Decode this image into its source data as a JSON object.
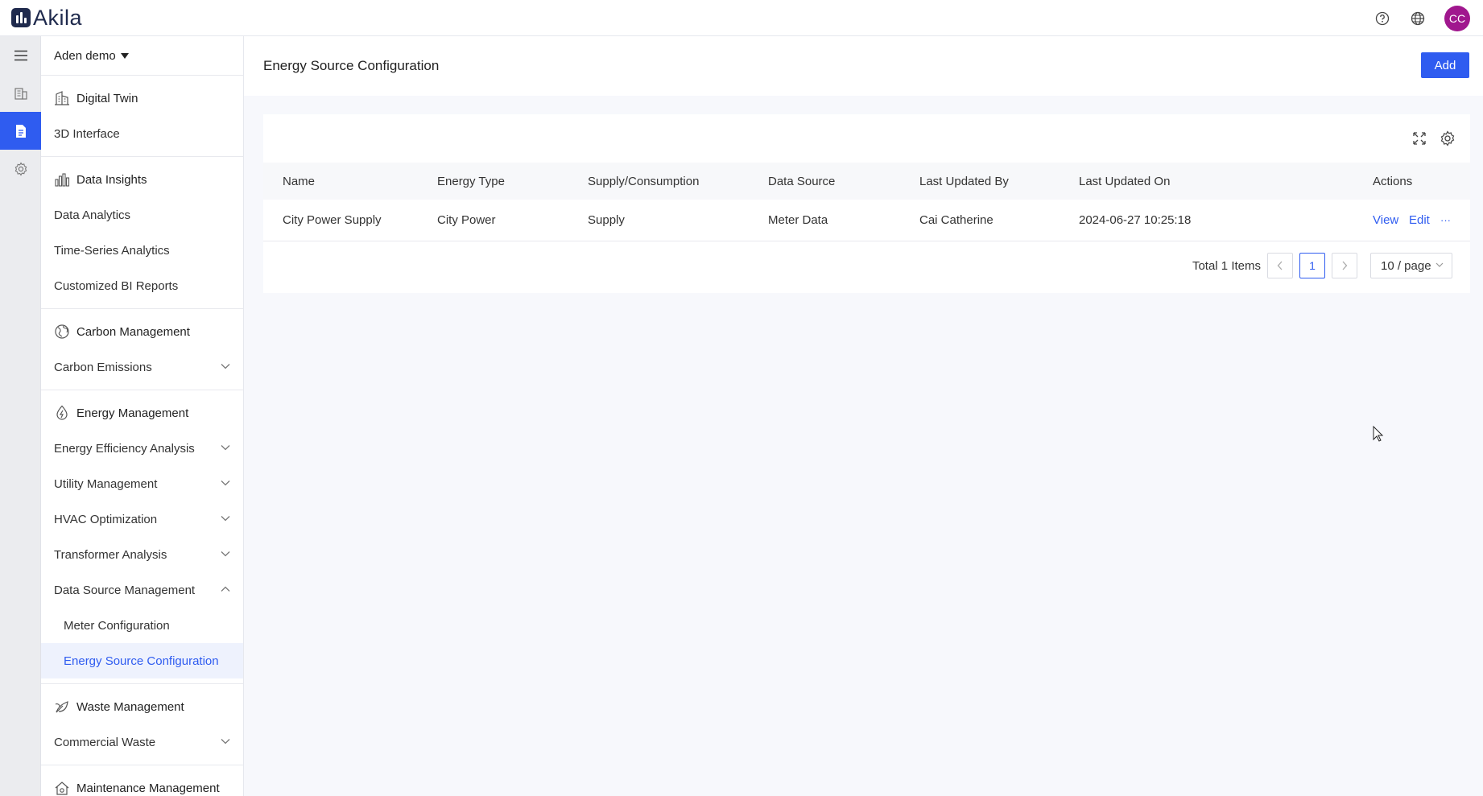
{
  "app": {
    "logo_text": "Akila"
  },
  "topbar": {
    "avatar_initials": "CC",
    "icons": [
      "help-icon",
      "globe-icon"
    ]
  },
  "rail": {
    "items": [
      "menu-icon",
      "building-icon",
      "document-icon",
      "gear-icon"
    ],
    "active_index": 2
  },
  "sidebar": {
    "project": "Aden demo",
    "groups": [
      {
        "title": "Digital Twin",
        "icon": "building-icon",
        "items": [
          {
            "label": "3D Interface",
            "expandable": false
          }
        ]
      },
      {
        "title": "Data Insights",
        "icon": "bar-chart-icon",
        "items": [
          {
            "label": "Data Analytics",
            "expandable": false
          },
          {
            "label": "Time-Series Analytics",
            "expandable": false
          },
          {
            "label": "Customized BI Reports",
            "expandable": false
          }
        ]
      },
      {
        "title": "Carbon Management",
        "icon": "globe-leaf-icon",
        "items": [
          {
            "label": "Carbon Emissions",
            "expandable": true
          }
        ]
      },
      {
        "title": "Energy Management",
        "icon": "energy-icon",
        "items": [
          {
            "label": "Energy Efficiency Analysis",
            "expandable": true
          },
          {
            "label": "Utility Management",
            "expandable": true
          },
          {
            "label": "HVAC Optimization",
            "expandable": true
          },
          {
            "label": "Transformer Analysis",
            "expandable": true
          },
          {
            "label": "Data Source Management",
            "expandable": true,
            "expanded": true
          }
        ]
      },
      {
        "title": "Waste Management",
        "icon": "leaf-icon",
        "items": [
          {
            "label": "Commercial Waste",
            "expandable": true
          }
        ]
      },
      {
        "title": "Maintenance Management",
        "icon": "house-gear-icon",
        "items": []
      }
    ],
    "data_source_sub": [
      {
        "label": "Meter Configuration",
        "active": false
      },
      {
        "label": "Energy Source Configuration",
        "active": true
      }
    ]
  },
  "page": {
    "title": "Energy Source Configuration",
    "add_label": "Add"
  },
  "table": {
    "columns": [
      "Name",
      "Energy Type",
      "Supply/Consumption",
      "Data Source",
      "Last Updated By",
      "Last Updated On",
      "Actions"
    ],
    "rows": [
      {
        "name": "City Power Supply",
        "energy_type": "City Power",
        "supply": "Supply",
        "data_source": "Meter Data",
        "updated_by": "Cai Catherine",
        "updated_on": "2024-06-27 10:25:18",
        "actions": [
          "View",
          "Edit",
          "···"
        ]
      }
    ]
  },
  "pagination": {
    "total_text": "Total 1 Items",
    "current_page": "1",
    "page_size": "10 / page"
  }
}
